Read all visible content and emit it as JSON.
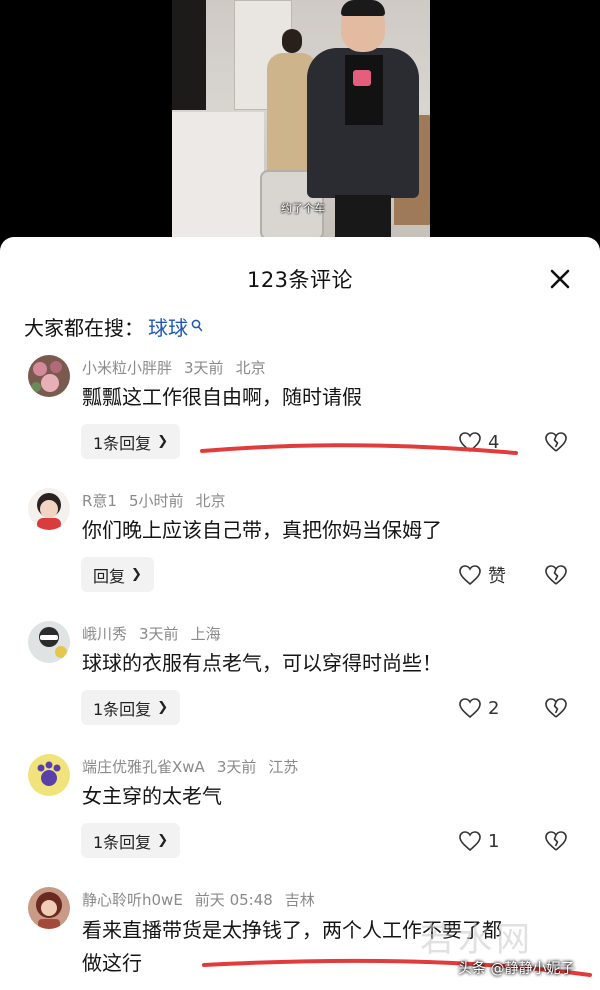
{
  "video": {
    "subtitle": "约了个车"
  },
  "sheet": {
    "title": "123条评论",
    "search_label": "大家都在搜：",
    "search_term": "球球",
    "search_icon": "search-icon"
  },
  "comments": [
    {
      "user": "小米粒小胖胖",
      "time": "3天前",
      "location": "北京",
      "text": "瓢瓢这工作很自由啊，随时请假",
      "reply": "1条回复",
      "likes": "4"
    },
    {
      "user": "R意1",
      "time": "5小时前",
      "location": "北京",
      "text": "你们晚上应该自己带，真把你妈当保姆了",
      "reply": "回复",
      "likes": "赞"
    },
    {
      "user": "峨川秀",
      "time": "3天前",
      "location": "上海",
      "text": "球球的衣服有点老气，可以穿得时尚些！",
      "reply": "1条回复",
      "likes": "2"
    },
    {
      "user": "端庄优雅孔雀XwA",
      "time": "3天前",
      "location": "江苏",
      "text": "女主穿的太老气",
      "reply": "1条回复",
      "likes": "1"
    },
    {
      "user": "静心聆听h0wE",
      "time": "前天 05:48",
      "location": "吉林",
      "text_line1": "看来直播带货是太挣钱了，两个人工作不要了都",
      "text_line2": "做这行"
    }
  ],
  "watermark": {
    "text": "若水网",
    "credit": "头条 @静静小妮子"
  },
  "colors": {
    "accent_link": "#1f58b8",
    "underline": "#e23b3b"
  }
}
